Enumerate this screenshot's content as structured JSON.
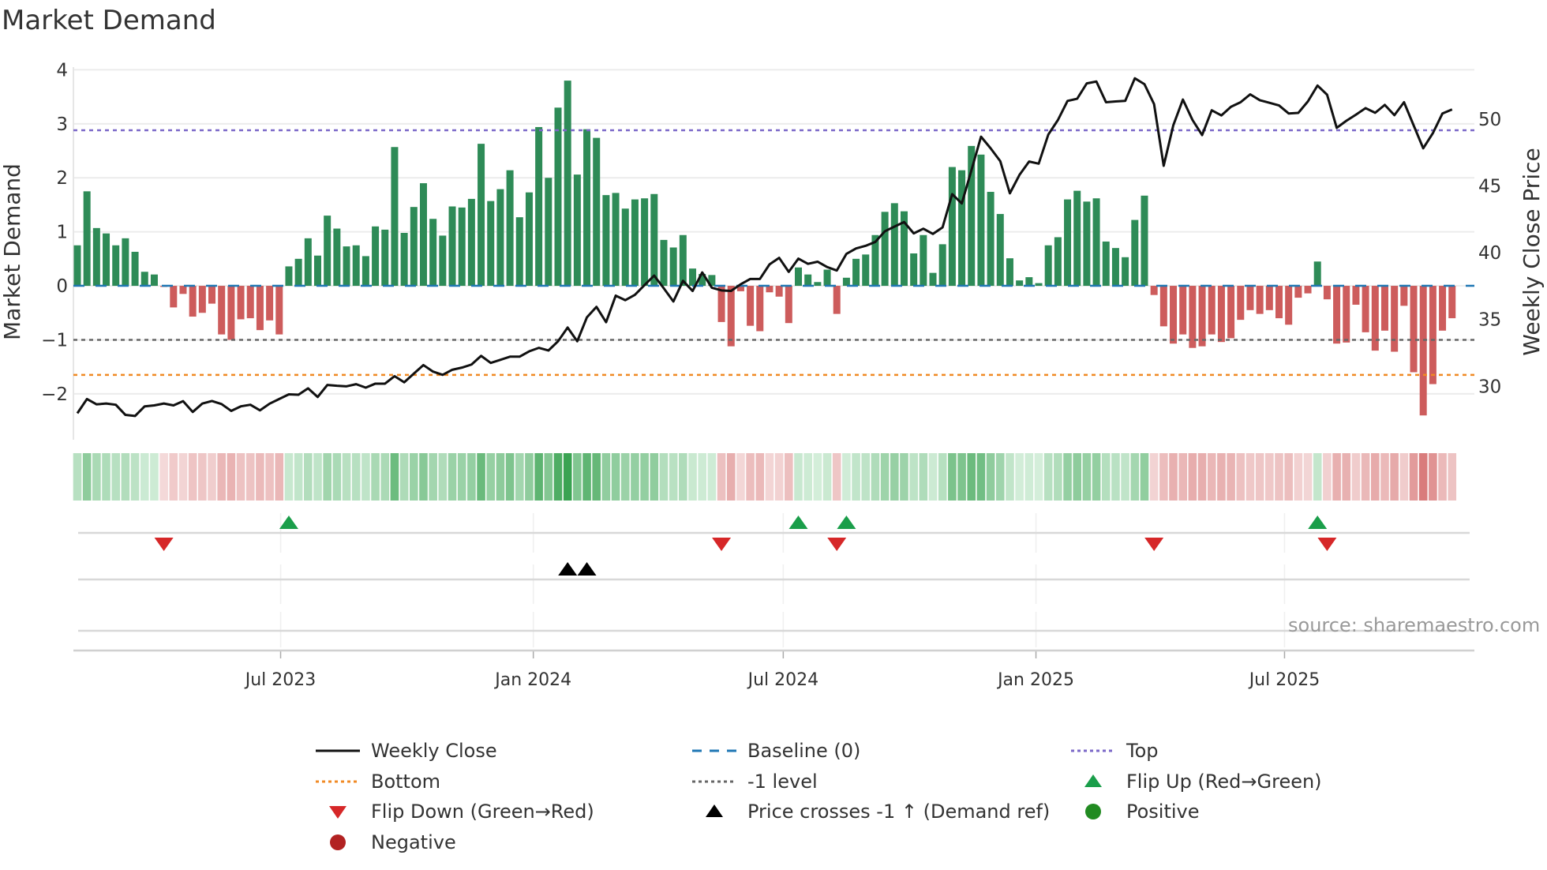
{
  "title": "Market Demand",
  "source": "source: sharemaestro.com",
  "legend": [
    {
      "label": "Weekly Close",
      "kind": "line",
      "color": "#111111",
      "dash": ""
    },
    {
      "label": "Baseline (0)",
      "kind": "line",
      "color": "#1f77b4",
      "dash": "12,10"
    },
    {
      "label": "Top",
      "kind": "line",
      "color": "#7b68c8",
      "dash": "4,4"
    },
    {
      "label": "Bottom",
      "kind": "line",
      "color": "#f08a24",
      "dash": "4,4"
    },
    {
      "label": "-1 level",
      "kind": "line",
      "color": "#666666",
      "dash": "4,4"
    },
    {
      "label": "Flip Up (Red→Green)",
      "kind": "tri-up",
      "color": "#1a9e4a"
    },
    {
      "label": "Flip Down (Green→Red)",
      "kind": "tri-down",
      "color": "#d62728"
    },
    {
      "label": "Price crosses -1 ↑ (Demand ref)",
      "kind": "tri-up",
      "color": "#000000"
    },
    {
      "label": "Positive",
      "kind": "dot",
      "color": "#228b22"
    },
    {
      "label": "Negative",
      "kind": "dot",
      "color": "#b22222"
    }
  ],
  "chart_data": {
    "type": "bar",
    "title": "Market Demand",
    "ylabel": "Market Demand",
    "y2label": "Weekly Close Price",
    "ylim": [
      -2.85,
      4.05
    ],
    "y2lim": [
      26.0,
      53.9
    ],
    "yticks": [
      -2,
      -1,
      0,
      1,
      2,
      3,
      4
    ],
    "y2ticks": [
      30,
      35,
      40,
      45,
      50
    ],
    "start_date": "2023-02-03",
    "interval_days": 7,
    "xticks": [
      {
        "date": "2023-07-01",
        "label": "Jul 2023"
      },
      {
        "date": "2024-01-01",
        "label": "Jan 2024"
      },
      {
        "date": "2024-07-01",
        "label": "Jul 2024"
      },
      {
        "date": "2025-01-01",
        "label": "Jan 2025"
      },
      {
        "date": "2025-07-01",
        "label": "Jul 2025"
      }
    ],
    "levels": {
      "baseline": 0,
      "top": 2.88,
      "minus_one": -1,
      "bottom": -1.65
    },
    "colors": {
      "positive": "#2e8b57",
      "negative": "#cd5c5c",
      "baseline": "#1f77b4",
      "top": "#7b68c8",
      "minus_one": "#666666",
      "bottom": "#f08a24",
      "price": "#111111"
    },
    "demand": [
      0.75,
      1.75,
      1.07,
      0.97,
      0.75,
      0.88,
      0.63,
      0.26,
      0.21,
      -0.02,
      -0.4,
      -0.15,
      -0.57,
      -0.5,
      -0.33,
      -0.9,
      -1.0,
      -0.62,
      -0.6,
      -0.82,
      -0.64,
      -0.9,
      0.36,
      0.5,
      0.88,
      0.56,
      1.3,
      1.06,
      0.73,
      0.75,
      0.55,
      1.1,
      1.04,
      2.57,
      0.98,
      1.46,
      1.9,
      1.24,
      0.93,
      1.47,
      1.45,
      1.61,
      2.63,
      1.57,
      1.79,
      2.14,
      1.27,
      1.73,
      2.94,
      2.0,
      3.3,
      3.8,
      2.06,
      2.9,
      2.74,
      1.68,
      1.72,
      1.43,
      1.6,
      1.62,
      1.7,
      0.85,
      0.71,
      0.94,
      0.32,
      0.22,
      0.2,
      -0.67,
      -1.12,
      -0.1,
      -0.74,
      -0.84,
      -0.12,
      -0.2,
      -0.69,
      0.34,
      0.21,
      0.07,
      0.3,
      -0.52,
      0.15,
      0.5,
      0.58,
      0.94,
      1.37,
      1.53,
      1.38,
      0.6,
      0.94,
      0.24,
      0.77,
      2.2,
      2.14,
      2.59,
      2.43,
      1.74,
      1.33,
      0.51,
      0.1,
      0.16,
      0.05,
      0.75,
      0.9,
      1.6,
      1.76,
      1.56,
      1.62,
      0.82,
      0.7,
      0.53,
      1.22,
      1.67,
      -0.17,
      -0.75,
      -1.07,
      -0.9,
      -1.15,
      -1.12,
      -0.9,
      -1.04,
      -0.97,
      -0.63,
      -0.45,
      -0.52,
      -0.45,
      -0.6,
      -0.72,
      -0.22,
      -0.14,
      0.45,
      -0.25,
      -1.07,
      -1.05,
      -0.35,
      -0.86,
      -1.2,
      -0.83,
      -1.22,
      -0.37,
      -1.6,
      -2.4,
      -1.82,
      -0.83,
      -0.6
    ],
    "price": [
      27.98,
      29.05,
      28.65,
      28.71,
      28.62,
      27.86,
      27.78,
      28.5,
      28.57,
      28.71,
      28.57,
      28.89,
      28.08,
      28.71,
      28.9,
      28.67,
      28.16,
      28.5,
      28.62,
      28.2,
      28.7,
      29.05,
      29.4,
      29.37,
      29.85,
      29.2,
      30.1,
      30.04,
      30.0,
      30.16,
      29.9,
      30.2,
      30.2,
      30.76,
      30.3,
      30.95,
      31.59,
      31.1,
      30.86,
      31.24,
      31.4,
      31.63,
      32.28,
      31.75,
      31.98,
      32.22,
      32.22,
      32.62,
      32.88,
      32.68,
      33.37,
      34.4,
      33.37,
      35.16,
      35.95,
      34.8,
      36.79,
      36.45,
      36.85,
      37.58,
      38.29,
      37.34,
      36.35,
      37.9,
      37.14,
      38.53,
      37.38,
      37.18,
      37.14,
      37.64,
      38.04,
      38.04,
      39.13,
      39.62,
      38.57,
      39.56,
      39.17,
      39.33,
      38.93,
      38.67,
      39.92,
      40.32,
      40.52,
      40.81,
      41.61,
      41.96,
      42.3,
      41.45,
      41.8,
      41.41,
      41.9,
      44.39,
      43.69,
      46.17,
      48.69,
      47.82,
      46.86,
      44.45,
      45.83,
      46.83,
      46.67,
      48.85,
      49.94,
      51.37,
      51.53,
      52.68,
      52.82,
      51.27,
      51.33,
      51.37,
      53.06,
      52.62,
      51.13,
      46.51,
      49.54,
      51.47,
      49.94,
      48.81,
      50.67,
      50.28,
      50.93,
      51.27,
      51.86,
      51.42,
      51.23,
      51.03,
      50.43,
      50.47,
      51.33,
      52.52,
      51.83,
      49.35,
      49.88,
      50.34,
      50.83,
      50.48,
      51.07,
      50.3,
      51.27,
      49.54,
      47.82,
      48.95,
      50.43,
      50.73
    ],
    "markers": {
      "flip_up_weeks": [
        22,
        75,
        80,
        129
      ],
      "flip_down_weeks": [
        9,
        67,
        79,
        112,
        130
      ],
      "price_cross_weeks": [
        51,
        53
      ]
    }
  }
}
